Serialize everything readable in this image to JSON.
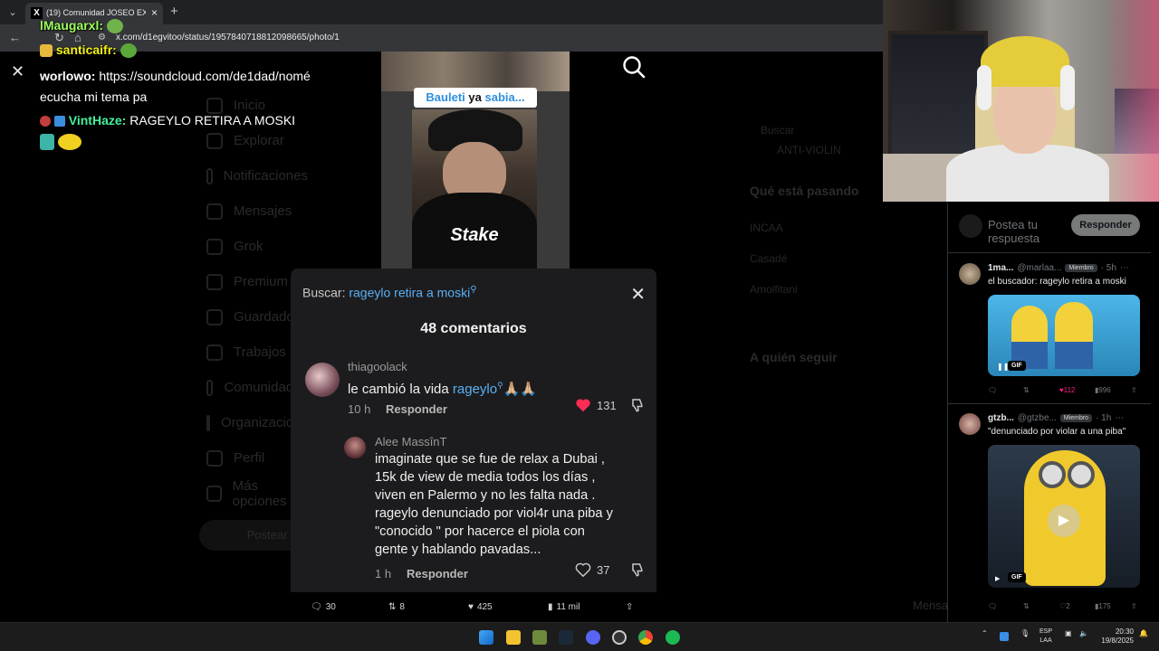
{
  "browser": {
    "tab_title": "(19) Comunidad JOSEO EXCLUS",
    "tab_favicon": "X",
    "url": "x.com/d1egvitoo/status/1957840718812098665/photo/1"
  },
  "chat": [
    {
      "user": "lMaugarxl:",
      "text": ""
    },
    {
      "user": "santicaifr:",
      "text": ""
    },
    {
      "user": "worlowo:",
      "text": "https://soundcloud.com/de1dad/nomé"
    },
    {
      "user": "",
      "text": "ecucha mi tema pa"
    },
    {
      "user": "VintHaze:",
      "text": "RAGEYLO RETIRA A MOSKI"
    }
  ],
  "media": {
    "caption_part1": "Bauleti",
    "caption_part2": "ya",
    "caption_part3": "sabia...",
    "overlay_text": "Stake"
  },
  "left_nav": [
    "Inicio",
    "Explorar",
    "Notificaciones",
    "Mensajes",
    "Grok",
    "Premium",
    "Guardados",
    "Trabajos",
    "Comunidades",
    "Organizaciones",
    "Perfil",
    "Más opciones"
  ],
  "post_button": "Postear",
  "dim_right": {
    "search": "Buscar",
    "anti": "ANTI-VIOLIN",
    "trends_title": "Qué está pasando",
    "trend1": "INCAA",
    "trend2": "Casadé",
    "trend3": "Amolfitani",
    "follow_title": "A quién seguir",
    "bottom": "Mensajes"
  },
  "comments": {
    "search_label": "Buscar:",
    "search_query": "rageylo retira a moski",
    "count_label": "48 comentarios",
    "items": [
      {
        "user": "thiagoolack",
        "text_before": "le cambió la vida",
        "text_link": "rageylo",
        "text_after": "🙏🏼🙏🏼",
        "time": "10 h",
        "reply": "Responder",
        "likes": "131"
      },
      {
        "user": "Alee MassînT",
        "text": "imaginate que se fue de relax a Dubai ,\n15k de view de media todos los días ,\nviven en Palermo y no les falta nada .\nrageylo denunciado por viol4r una piba y\n\"conocido \" por hacerce el piola con\ngente y hablando pavadas...",
        "time": "1 h",
        "reply": "Responder",
        "likes": "37"
      }
    ]
  },
  "actions": {
    "replies": "30",
    "reposts": "8",
    "likes": "425",
    "views": "11 mil"
  },
  "right_panel": {
    "reply_placeholder": "Postea tu respuesta",
    "reply_button": "Responder",
    "tweets": [
      {
        "name": "1ma...",
        "handle": "@marlaa...",
        "badge": "Miembro",
        "time": "· 5h",
        "text": "el buscador: rageylo retira a moski",
        "gif": "GIF",
        "replies": "",
        "reposts": "",
        "likes": "112",
        "views": "996"
      },
      {
        "name": "gtzb...",
        "handle": "@gtzbe...",
        "badge": "Miembro",
        "time": "· 1h",
        "text": "\"denunciado por violar a una piba\"",
        "gif": "GIF",
        "replies": "",
        "reposts": "",
        "likes": "2",
        "views": "175"
      }
    ]
  },
  "taskbar": {
    "lang1": "ESP",
    "lang2": "LAA",
    "time": "20:30",
    "date": "19/8/2025"
  }
}
